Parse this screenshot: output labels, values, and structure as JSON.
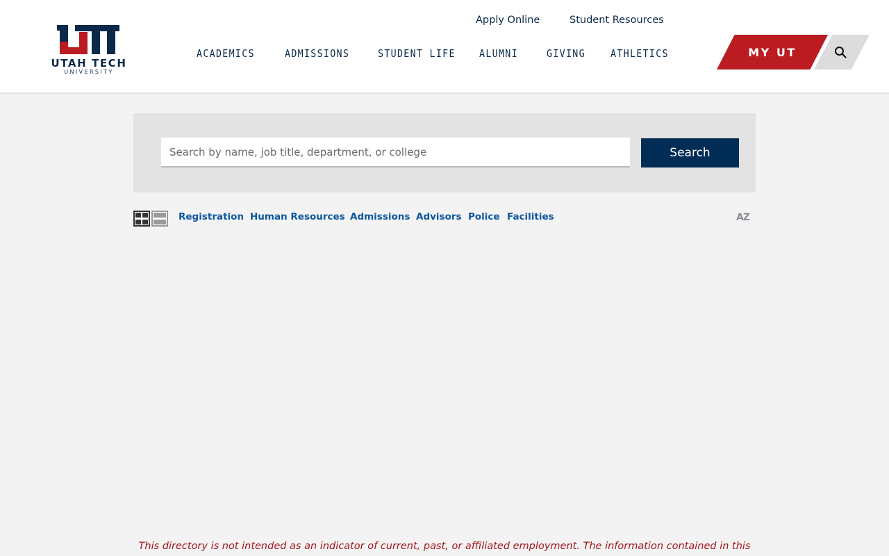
{
  "brand": {
    "monogram": "UT",
    "name": "UTAH TECH",
    "subname": "UNIVERSITY",
    "navy": "#0b2a4a",
    "red": "#ba1c21"
  },
  "utility_nav": {
    "apply_online": "Apply Online",
    "student_resources": "Student Resources"
  },
  "main_nav": {
    "items": [
      "ACADEMICS",
      "ADMISSIONS",
      "STUDENT LIFE",
      "ALUMNI",
      "GIVING",
      "ATHLETICS"
    ]
  },
  "myut": {
    "label": "MY UT"
  },
  "search": {
    "placeholder": "Search by name, job title, department, or college",
    "value": "",
    "button_label": "Search"
  },
  "quick_links": [
    "Registration",
    "Human Resources",
    "Admissions",
    "Advisors",
    "Police",
    "Facilities"
  ],
  "view_toggles": [
    "grid-view-icon",
    "list-view-icon"
  ],
  "az_icon": {
    "label": "AZ"
  },
  "disclaimer": "This directory is not intended as an indicator of current, past, or affiliated employment. The information contained in this"
}
